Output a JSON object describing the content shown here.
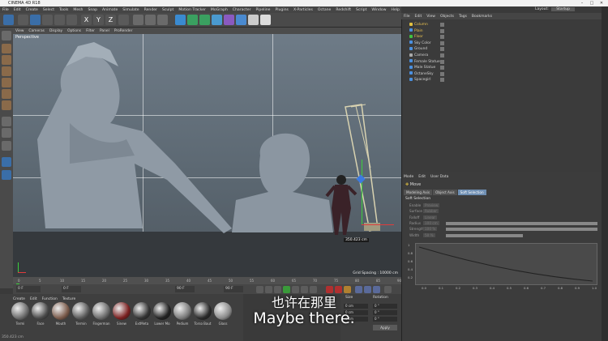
{
  "app": {
    "title": "CINEMA 4D R18",
    "layout_label": "Layout:",
    "layout_value": "Startup"
  },
  "menubar": [
    "File",
    "Edit",
    "Create",
    "Select",
    "Tools",
    "Mesh",
    "Snap",
    "Animate",
    "Simulate",
    "Render",
    "Sculpt",
    "Motion Tracker",
    "MoGraph",
    "Character",
    "Pipeline",
    "Plugins",
    "X-Particles",
    "Octane",
    "Redshift",
    "Script",
    "Window",
    "Help"
  ],
  "viewport_menu": [
    "View",
    "Cameras",
    "Display",
    "Options",
    "Filter",
    "Panel",
    "ProRender"
  ],
  "viewport": {
    "label": "Perspective",
    "grid_spacing": "Grid Spacing : 10000 cm",
    "readout": "350.423 cm"
  },
  "timeline": {
    "ticks": [
      "0",
      "5",
      "10",
      "15",
      "20",
      "25",
      "30",
      "35",
      "40",
      "45",
      "50",
      "55",
      "60",
      "65",
      "70",
      "75",
      "80",
      "85",
      "90"
    ],
    "frame_start": "0 F",
    "frame_field": "0 F",
    "frame_end": "90 F",
    "frame_end2": "90 F"
  },
  "materials": {
    "menu": [
      "Create",
      "Edit",
      "Function",
      "Texture"
    ],
    "items": [
      {
        "label": "Termi",
        "color": "#6b6b6b"
      },
      {
        "label": "Face",
        "color": "#4a4a4a"
      },
      {
        "label": "Mouth",
        "color": "#7a5a4a"
      },
      {
        "label": "Termin",
        "color": "#5a5a5a"
      },
      {
        "label": "Fingerman",
        "color": "#6a6a6a"
      },
      {
        "label": "Sinew",
        "color": "#7a1f1f"
      },
      {
        "label": "ExtMeta",
        "color": "#333333"
      },
      {
        "label": "Lower Mo",
        "color": "#222222"
      },
      {
        "label": "Pedium",
        "color": "#7a7a7a"
      },
      {
        "label": "Torso Baut",
        "color": "#2a2a2a"
      },
      {
        "label": "Glass",
        "color": "#8a8a8a"
      }
    ]
  },
  "coords": {
    "size_label": "Size",
    "rotation_label": "Rotation",
    "x": "0 cm",
    "y": "0 cm",
    "z": "0 cm",
    "h": "0 °",
    "p": "0 °",
    "b": "0 °",
    "apply": "Apply"
  },
  "object_manager": {
    "menu": [
      "File",
      "Edit",
      "View",
      "Objects",
      "Tags",
      "Bookmarks"
    ],
    "objects": [
      {
        "name": "Column",
        "color": "#e0c040"
      },
      {
        "name": "Plain",
        "color": "#4a90e0"
      },
      {
        "name": "Floor",
        "color": "#40c040"
      },
      {
        "name": "Sky Color",
        "color": "#4a90e0"
      },
      {
        "name": "Ground",
        "color": "#4a90e0"
      },
      {
        "name": "Camera",
        "color": "#aaaaaa"
      },
      {
        "name": "Female Statue",
        "color": "#4a90e0"
      },
      {
        "name": "Male Statue",
        "color": "#4a90e0"
      },
      {
        "name": "OctaneSky",
        "color": "#4a90e0"
      },
      {
        "name": "Spacegirl",
        "color": "#4a90e0"
      }
    ]
  },
  "attributes": {
    "menu": [
      "Mode",
      "Edit",
      "User Data"
    ],
    "mode_label": "Move",
    "tabs": [
      "Modeling Axis",
      "Object Axis",
      "Soft Selection"
    ],
    "active_tab": "Soft Selection",
    "section": "Soft Selection",
    "fields": [
      {
        "label": "Enable",
        "value": "Preview"
      },
      {
        "label": "Surface",
        "value": "Rubber"
      },
      {
        "label": "Falloff",
        "value": "Linear"
      },
      {
        "label": "Radius",
        "value": "100 cm"
      },
      {
        "label": "Strength",
        "value": "100 %"
      },
      {
        "label": "Width",
        "value": "50 %"
      }
    ],
    "graph_y": [
      "1",
      "0.8",
      "0.6",
      "0.4",
      "0.2"
    ],
    "graph_x": [
      "0.0",
      "0.1",
      "0.2",
      "0.3",
      "0.4",
      "0.5",
      "0.6",
      "0.7",
      "0.8",
      "0.9",
      "1.0"
    ]
  },
  "status": {
    "text": "350.423 cm"
  },
  "subtitles": {
    "chinese": "也许在那里",
    "english": "Maybe there."
  },
  "colors": {
    "viewport_top": "#6e7b87",
    "accent": "#6f8fb3"
  }
}
